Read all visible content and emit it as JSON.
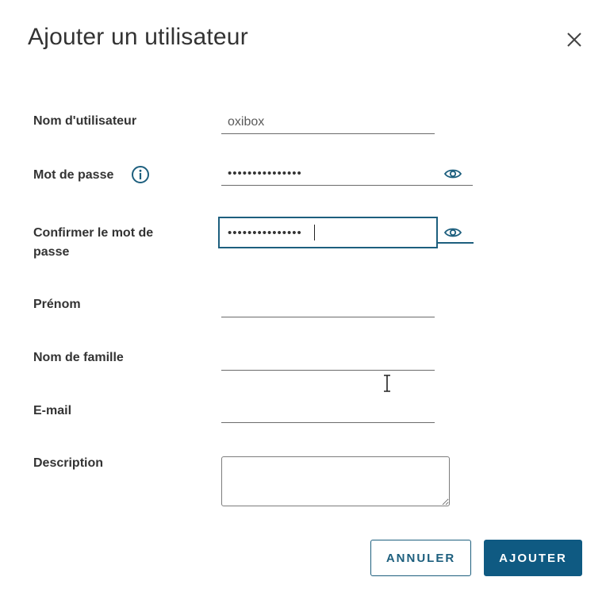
{
  "dialog": {
    "title": "Ajouter un utilisateur",
    "close_icon": "close-icon"
  },
  "form": {
    "username": {
      "label": "Nom d'utilisateur",
      "value": "oxibox"
    },
    "password": {
      "label": "Mot de passe",
      "info_icon": "info-icon",
      "value": "•••••••••••••••",
      "toggle_icon": "eye-icon"
    },
    "confirm_password": {
      "label_line1": "Confirmer le mot de",
      "label_line2": "passe",
      "value": "•••••••••••••••",
      "toggle_icon": "eye-icon"
    },
    "first_name": {
      "label": "Prénom",
      "value": ""
    },
    "last_name": {
      "label": "Nom de famille",
      "value": ""
    },
    "email": {
      "label": "E-mail",
      "value": ""
    },
    "description": {
      "label": "Description",
      "value": ""
    }
  },
  "buttons": {
    "cancel_label": "ANNULER",
    "add_label": "AJOUTER"
  },
  "colors": {
    "accent": "#0f5a82",
    "focus_border": "#1d5f7e",
    "text": "#333333"
  }
}
